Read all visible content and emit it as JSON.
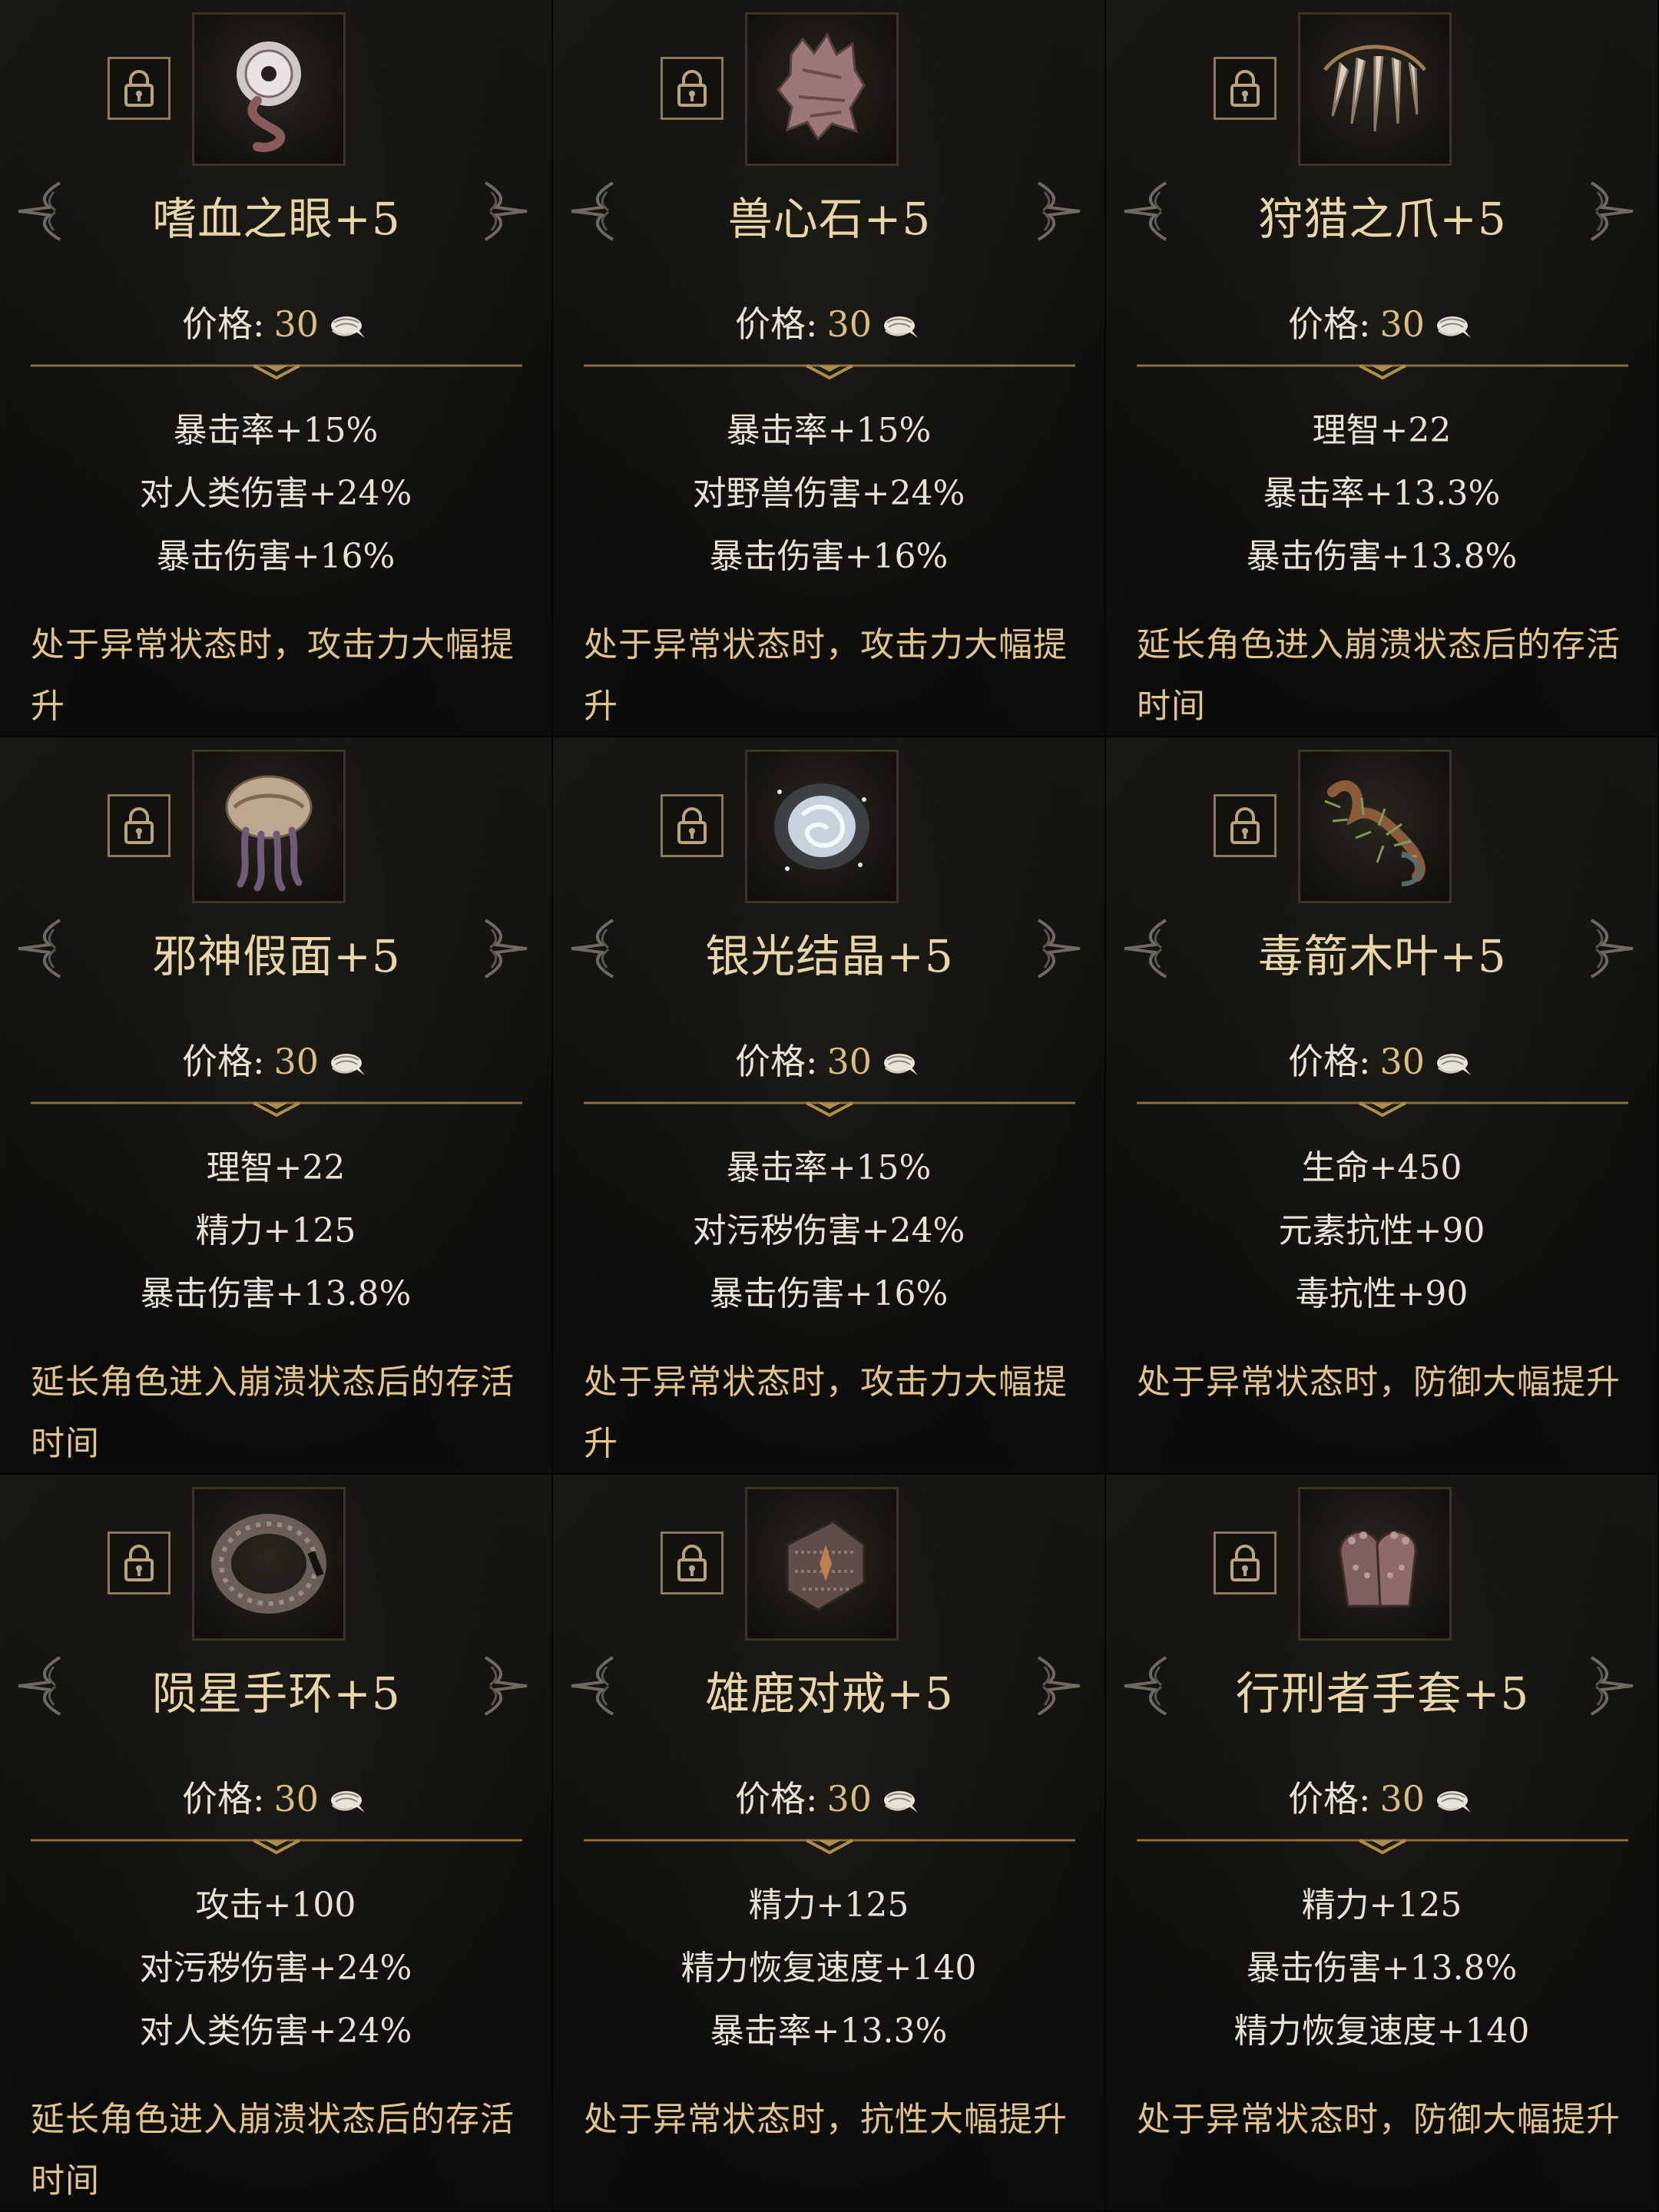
{
  "price_label": "价格:",
  "cards": [
    {
      "name": "嗜血之眼+5",
      "price": "30",
      "icon": "eye-tentacle-icon",
      "stats": [
        "暴击率+15%",
        "对人类伤害+24%",
        "暴击伤害+16%"
      ],
      "desc": "处于异常状态时，攻击力大幅提升"
    },
    {
      "name": "兽心石+5",
      "price": "30",
      "icon": "beast-heart-stone-icon",
      "stats": [
        "暴击率+15%",
        "对野兽伤害+24%",
        "暴击伤害+16%"
      ],
      "desc": "处于异常状态时，攻击力大幅提升"
    },
    {
      "name": "狩猎之爪+5",
      "price": "30",
      "icon": "claw-necklace-icon",
      "stats": [
        "理智+22",
        "暴击率+13.3%",
        "暴击伤害+13.8%"
      ],
      "desc": "延长角色进入崩溃状态后的存活时间"
    },
    {
      "name": "邪神假面+5",
      "price": "30",
      "icon": "tentacle-mask-icon",
      "stats": [
        "理智+22",
        "精力+125",
        "暴击伤害+13.8%"
      ],
      "desc": "延长角色进入崩溃状态后的存活时间"
    },
    {
      "name": "银光结晶+5",
      "price": "30",
      "icon": "silver-crystal-icon",
      "stats": [
        "暴击率+15%",
        "对污秽伤害+24%",
        "暴击伤害+16%"
      ],
      "desc": "处于异常状态时，攻击力大幅提升"
    },
    {
      "name": "毒箭木叶+5",
      "price": "30",
      "icon": "poison-leaf-icon",
      "stats": [
        "生命+450",
        "元素抗性+90",
        "毒抗性+90"
      ],
      "desc": "处于异常状态时，防御大幅提升"
    },
    {
      "name": "陨星手环+5",
      "price": "30",
      "icon": "meteor-bracelet-icon",
      "stats": [
        "攻击+100",
        "对污秽伤害+24%",
        "对人类伤害+24%"
      ],
      "desc": "延长角色进入崩溃状态后的存活时间"
    },
    {
      "name": "雄鹿对戒+5",
      "price": "30",
      "icon": "stag-ring-icon",
      "stats": [
        "精力+125",
        "精力恢复速度+140",
        "暴击率+13.3%"
      ],
      "desc": "处于异常状态时，抗性大幅提升"
    },
    {
      "name": "行刑者手套+5",
      "price": "30",
      "icon": "executioner-gloves-icon",
      "stats": [
        "精力+125",
        "暴击伤害+13.8%",
        "精力恢复速度+140"
      ],
      "desc": "处于异常状态时，防御大幅提升"
    }
  ]
}
